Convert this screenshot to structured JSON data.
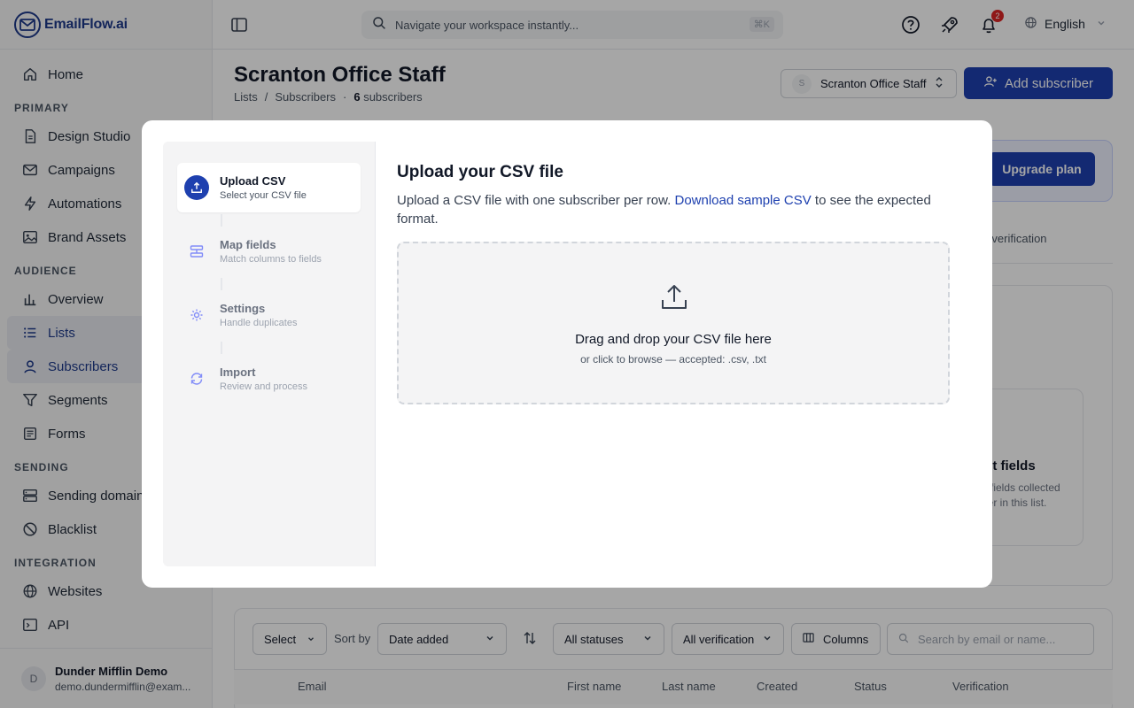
{
  "app": {
    "logo_text": "EmailFlow.ai"
  },
  "sidebar": {
    "home": "Home",
    "sections": {
      "primary": "PRIMARY",
      "audience": "AUDIENCE",
      "sending": "SENDING",
      "integration": "INTEGRATION"
    },
    "primary_items": [
      "Design Studio",
      "Campaigns",
      "Automations",
      "Brand Assets"
    ],
    "audience_items": [
      "Overview",
      "Lists",
      "Subscribers",
      "Segments",
      "Forms"
    ],
    "sending_items": [
      "Sending domain",
      "Blacklist"
    ],
    "integration_items": [
      "Websites",
      "API"
    ],
    "user": {
      "initial": "D",
      "name": "Dunder Mifflin Demo",
      "email": "demo.dundermifflin@exam..."
    }
  },
  "topbar": {
    "search_placeholder": "Navigate your workspace instantly...",
    "search_shortcut": "⌘K",
    "notification_count": "2",
    "language": "English"
  },
  "header": {
    "title": "Scranton Office Staff",
    "breadcrumb": {
      "lists": "Lists",
      "sep": "/",
      "subscribers": "Subscribers",
      "dot": "·",
      "count": "6",
      "count_label": "subscribers"
    },
    "list_selector": {
      "initial": "S",
      "label": "Scranton Office Staff"
    },
    "add_button": "Add subscriber"
  },
  "background": {
    "upgrade_button": "Upgrade plan",
    "tab_peek": "il verification",
    "field_card_title": "st fields",
    "field_card_desc": "n fields collected\nber in this list.",
    "controls": {
      "select": "Select",
      "sort_by": "Sort by",
      "sort_value": "Date added",
      "status": "All statuses",
      "verification": "All verification",
      "columns": "Columns",
      "search_placeholder": "Search by email or name..."
    },
    "columns": [
      "Email",
      "First name",
      "Last name",
      "Created",
      "Status",
      "Verification"
    ]
  },
  "modal": {
    "steps": [
      {
        "title": "Upload CSV",
        "subtitle": "Select your CSV file"
      },
      {
        "title": "Map fields",
        "subtitle": "Match columns to fields"
      },
      {
        "title": "Settings",
        "subtitle": "Handle duplicates"
      },
      {
        "title": "Import",
        "subtitle": "Review and process"
      }
    ],
    "title": "Upload your CSV file",
    "desc_before": "Upload a CSV file with one subscriber per row.",
    "desc_link": "Download sample CSV",
    "desc_after": "to see the expected format.",
    "drop_title": "Drag and drop your CSV file here",
    "drop_subtitle": "or click to browse — accepted: .csv, .txt"
  },
  "colors": {
    "accent": "#1e40af",
    "brand": "#1e3a8a",
    "badge": "#dc2626"
  }
}
